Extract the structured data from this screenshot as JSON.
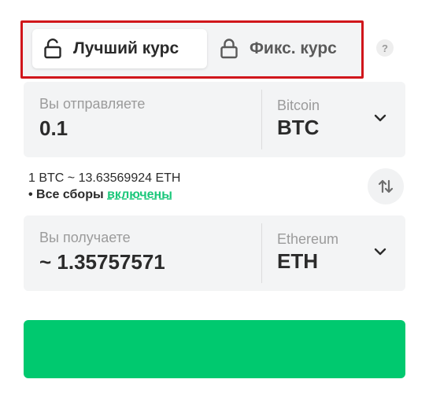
{
  "rate_toggle": {
    "best_label": "Лучший курс",
    "fixed_label": "Фикс. курс",
    "help_symbol": "?",
    "highlight_color": "#d0161b"
  },
  "send": {
    "label": "Вы отправляете",
    "amount": "0.1",
    "currency_name": "Bitcoin",
    "currency_ticker": "BTC"
  },
  "rate_info": {
    "rate_text": "1 BTC ~ 13.63569924 ETH",
    "fees_prefix": "• Все сборы ",
    "fees_link": "включены",
    "link_color": "#1ac77a"
  },
  "receive": {
    "label": "Вы получаете",
    "amount": "~ 1.35757571",
    "currency_name": "Ethereum",
    "currency_ticker": "ETH"
  },
  "icons": {
    "lock": "lock-icon",
    "help": "question-icon",
    "chevron": "chevron-down-icon",
    "swap": "swap-arrows-icon"
  },
  "exchange_button": {
    "label": "",
    "color": "#00c96f"
  }
}
